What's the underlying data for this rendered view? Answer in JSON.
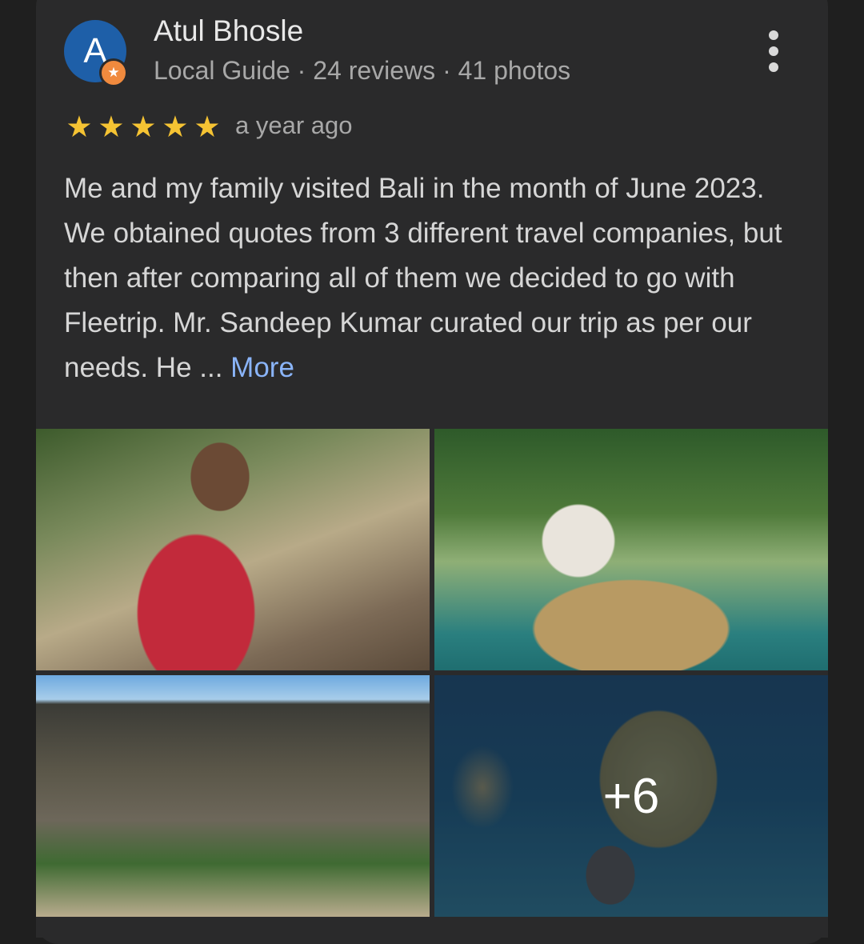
{
  "reviewer": {
    "initial": "A",
    "name": "Atul Bhosle",
    "meta": "Local Guide · 24 reviews · 41 photos",
    "badge_icon": "local-guide-star-icon"
  },
  "rating": {
    "stars": 5,
    "max": 5,
    "time": "a year ago"
  },
  "review": {
    "text": "Me and my family visited Bali in the month of June 2023. We obtained quotes from 3 different travel companies, but then after comparing all of them we decided to go with Fleetrip. Mr. Sandeep Kumar curated our trip as per our needs. He ... ",
    "more_label": "More"
  },
  "photos": {
    "extra_count_label": "+6",
    "items": [
      "man-with-iguana-photo",
      "floating-breakfast-photo",
      "angels-billabong-sign-photo",
      "kelingking-beach-photo"
    ]
  },
  "colors": {
    "card": "#2a2a2b",
    "accent_link": "#8ab4f8",
    "star": "#f5c333",
    "avatar": "#1e5fa8",
    "badge": "#f08a3e"
  }
}
